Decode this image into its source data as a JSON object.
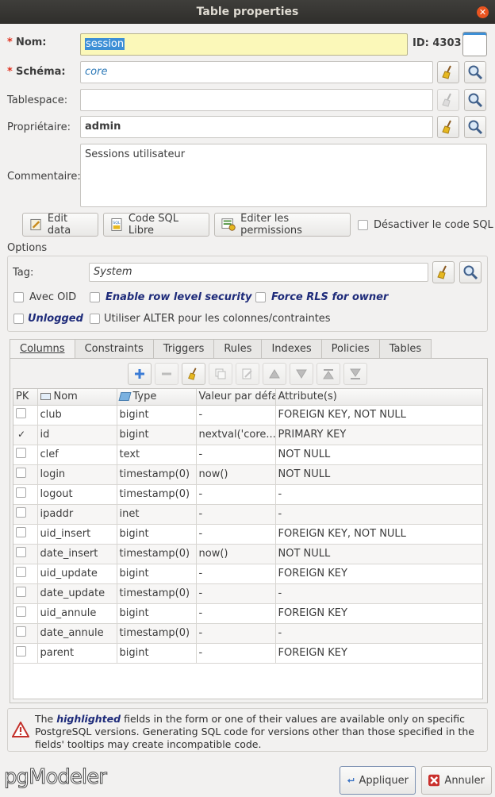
{
  "window": {
    "title": "Table properties"
  },
  "form": {
    "nom_label": "Nom:",
    "nom_value": "session",
    "id_label": "ID: 4303",
    "schema_label": "Schéma:",
    "schema_value": "core",
    "tablespace_label": "Tablespace:",
    "tablespace_value": "",
    "owner_label": "Propriétaire:",
    "owner_value": "admin",
    "comment_label": "Commentaire:",
    "comment_value": "Sessions utilisateur",
    "required_mark": "*"
  },
  "actions": {
    "edit_data": "Edit data",
    "sql_libre": "Code SQL Libre",
    "permissions": "Editer les permissions",
    "disable_sql": "Désactiver le code SQL"
  },
  "options": {
    "title": "Options",
    "tag_label": "Tag:",
    "tag_value": "System",
    "avec_oid": "Avec OID",
    "enable_rls": "Enable row level security",
    "force_rls": "Force RLS for owner",
    "unlogged": "Unlogged",
    "use_alter": "Utiliser ALTER pour les colonnes/contraintes"
  },
  "tabs": [
    "Columns",
    "Constraints",
    "Triggers",
    "Rules",
    "Indexes",
    "Policies",
    "Tables"
  ],
  "columns_table": {
    "headers": [
      "PK",
      "Nom",
      "Type",
      "Valeur par défaut",
      "Attribute(s)"
    ],
    "rows": [
      {
        "pk": false,
        "name": "club",
        "type": "bigint",
        "default": "-",
        "attrs": "FOREIGN KEY, NOT NULL"
      },
      {
        "pk": true,
        "name": "id",
        "type": "bigint",
        "default": "nextval('core...",
        "attrs": "PRIMARY KEY"
      },
      {
        "pk": false,
        "name": "clef",
        "type": "text",
        "default": "-",
        "attrs": "NOT NULL"
      },
      {
        "pk": false,
        "name": "login",
        "type": "timestamp(0)",
        "default": "now()",
        "attrs": "NOT NULL"
      },
      {
        "pk": false,
        "name": "logout",
        "type": "timestamp(0)",
        "default": "-",
        "attrs": "-"
      },
      {
        "pk": false,
        "name": "ipaddr",
        "type": "inet",
        "default": "-",
        "attrs": "-"
      },
      {
        "pk": false,
        "name": "uid_insert",
        "type": "bigint",
        "default": "-",
        "attrs": "FOREIGN KEY, NOT NULL"
      },
      {
        "pk": false,
        "name": "date_insert",
        "type": "timestamp(0)",
        "default": "now()",
        "attrs": "NOT NULL"
      },
      {
        "pk": false,
        "name": "uid_update",
        "type": "bigint",
        "default": "-",
        "attrs": "FOREIGN KEY"
      },
      {
        "pk": false,
        "name": "date_update",
        "type": "timestamp(0)",
        "default": "-",
        "attrs": "-"
      },
      {
        "pk": false,
        "name": "uid_annule",
        "type": "bigint",
        "default": "-",
        "attrs": "FOREIGN KEY"
      },
      {
        "pk": false,
        "name": "date_annule",
        "type": "timestamp(0)",
        "default": "-",
        "attrs": "-"
      },
      {
        "pk": false,
        "name": "parent",
        "type": "bigint",
        "default": "-",
        "attrs": "FOREIGN KEY"
      }
    ]
  },
  "notice": {
    "pre": "The ",
    "highlight": "highlighted",
    "post": " fields in the form or one of their values are available only on specific PostgreSQL versions. Generating SQL code for versions other than those specified in the fields' tooltips may create incompatible code."
  },
  "footer": {
    "logo": "pgModeler",
    "apply": "Appliquer",
    "cancel": "Annuler"
  },
  "colors": {
    "accent": "#e95420",
    "required": "#e0301e",
    "highlight": "#1e2b7a",
    "name_field_bg": "#fbf8b9"
  }
}
